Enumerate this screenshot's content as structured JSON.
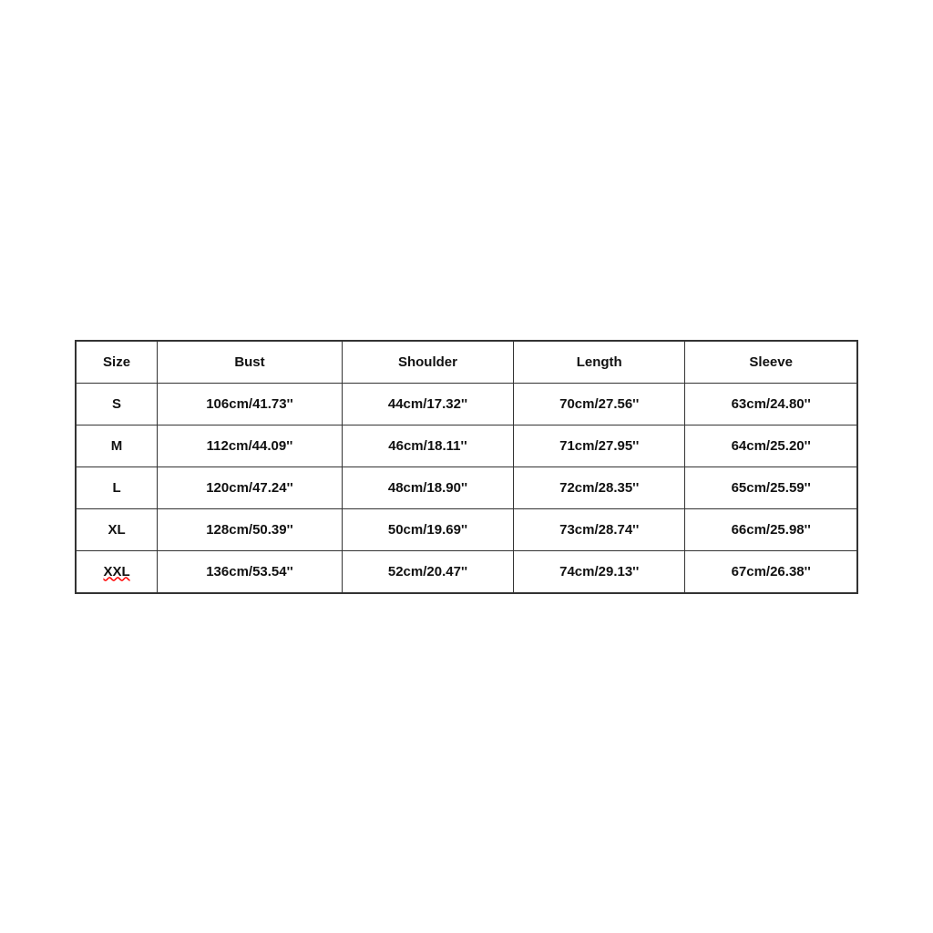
{
  "table": {
    "headers": [
      "Size",
      "Bust",
      "Shoulder",
      "Length",
      "Sleeve"
    ],
    "rows": [
      {
        "size": "S",
        "bust": "106cm/41.73''",
        "shoulder": "44cm/17.32''",
        "length": "70cm/27.56''",
        "sleeve": "63cm/24.80''"
      },
      {
        "size": "M",
        "bust": "112cm/44.09''",
        "shoulder": "46cm/18.11''",
        "length": "71cm/27.95''",
        "sleeve": "64cm/25.20''"
      },
      {
        "size": "L",
        "bust": "120cm/47.24''",
        "shoulder": "48cm/18.90''",
        "length": "72cm/28.35''",
        "sleeve": "65cm/25.59''"
      },
      {
        "size": "XL",
        "bust": "128cm/50.39''",
        "shoulder": "50cm/19.69''",
        "length": "73cm/28.74''",
        "sleeve": "66cm/25.98''"
      },
      {
        "size": "XXL",
        "bust": "136cm/53.54''",
        "shoulder": "52cm/20.47''",
        "length": "74cm/29.13''",
        "sleeve": "67cm/26.38''"
      }
    ]
  }
}
